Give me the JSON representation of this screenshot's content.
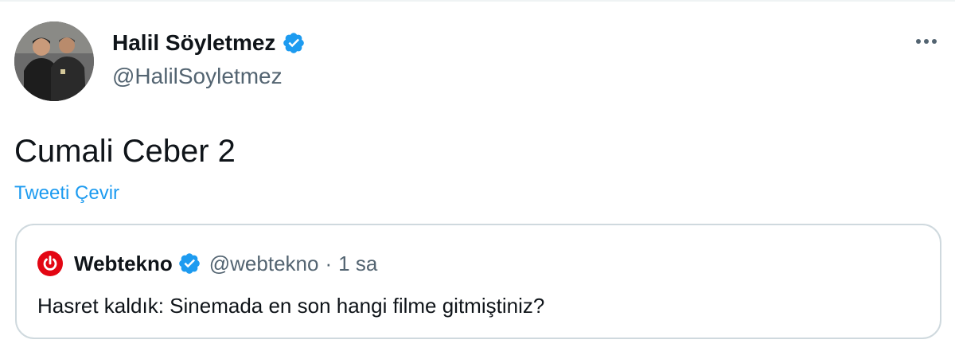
{
  "author": {
    "display_name": "Halil Söyletmez",
    "handle": "@HalilSoyletmez",
    "verified": true,
    "avatar_icon": "profile-photo"
  },
  "tweet": {
    "text": "Cumali Ceber 2",
    "translate_label": "Tweeti Çevir"
  },
  "quoted_tweet": {
    "display_name": "Webtekno",
    "handle": "@webtekno",
    "separator": "·",
    "time": "1 sa",
    "verified": true,
    "logo_icon": "power-icon",
    "text": "Hasret kaldık: Sinemada en son hangi filme gitmiştiniz?"
  },
  "colors": {
    "accent": "#1d9bf0",
    "text": "#0f1419",
    "secondary": "#536471",
    "border": "#cfd9de",
    "webtekno_red": "#e30613"
  }
}
